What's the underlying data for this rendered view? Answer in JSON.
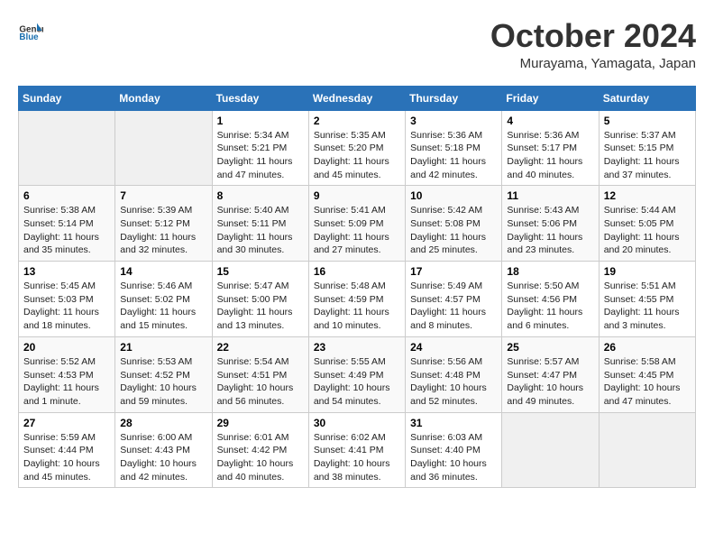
{
  "header": {
    "logo_general": "General",
    "logo_blue": "Blue",
    "month_title": "October 2024",
    "subtitle": "Murayama, Yamagata, Japan"
  },
  "columns": [
    "Sunday",
    "Monday",
    "Tuesday",
    "Wednesday",
    "Thursday",
    "Friday",
    "Saturday"
  ],
  "weeks": [
    [
      {
        "day": "",
        "info": ""
      },
      {
        "day": "",
        "info": ""
      },
      {
        "day": "1",
        "info": "Sunrise: 5:34 AM\nSunset: 5:21 PM\nDaylight: 11 hours and 47 minutes."
      },
      {
        "day": "2",
        "info": "Sunrise: 5:35 AM\nSunset: 5:20 PM\nDaylight: 11 hours and 45 minutes."
      },
      {
        "day": "3",
        "info": "Sunrise: 5:36 AM\nSunset: 5:18 PM\nDaylight: 11 hours and 42 minutes."
      },
      {
        "day": "4",
        "info": "Sunrise: 5:36 AM\nSunset: 5:17 PM\nDaylight: 11 hours and 40 minutes."
      },
      {
        "day": "5",
        "info": "Sunrise: 5:37 AM\nSunset: 5:15 PM\nDaylight: 11 hours and 37 minutes."
      }
    ],
    [
      {
        "day": "6",
        "info": "Sunrise: 5:38 AM\nSunset: 5:14 PM\nDaylight: 11 hours and 35 minutes."
      },
      {
        "day": "7",
        "info": "Sunrise: 5:39 AM\nSunset: 5:12 PM\nDaylight: 11 hours and 32 minutes."
      },
      {
        "day": "8",
        "info": "Sunrise: 5:40 AM\nSunset: 5:11 PM\nDaylight: 11 hours and 30 minutes."
      },
      {
        "day": "9",
        "info": "Sunrise: 5:41 AM\nSunset: 5:09 PM\nDaylight: 11 hours and 27 minutes."
      },
      {
        "day": "10",
        "info": "Sunrise: 5:42 AM\nSunset: 5:08 PM\nDaylight: 11 hours and 25 minutes."
      },
      {
        "day": "11",
        "info": "Sunrise: 5:43 AM\nSunset: 5:06 PM\nDaylight: 11 hours and 23 minutes."
      },
      {
        "day": "12",
        "info": "Sunrise: 5:44 AM\nSunset: 5:05 PM\nDaylight: 11 hours and 20 minutes."
      }
    ],
    [
      {
        "day": "13",
        "info": "Sunrise: 5:45 AM\nSunset: 5:03 PM\nDaylight: 11 hours and 18 minutes."
      },
      {
        "day": "14",
        "info": "Sunrise: 5:46 AM\nSunset: 5:02 PM\nDaylight: 11 hours and 15 minutes."
      },
      {
        "day": "15",
        "info": "Sunrise: 5:47 AM\nSunset: 5:00 PM\nDaylight: 11 hours and 13 minutes."
      },
      {
        "day": "16",
        "info": "Sunrise: 5:48 AM\nSunset: 4:59 PM\nDaylight: 11 hours and 10 minutes."
      },
      {
        "day": "17",
        "info": "Sunrise: 5:49 AM\nSunset: 4:57 PM\nDaylight: 11 hours and 8 minutes."
      },
      {
        "day": "18",
        "info": "Sunrise: 5:50 AM\nSunset: 4:56 PM\nDaylight: 11 hours and 6 minutes."
      },
      {
        "day": "19",
        "info": "Sunrise: 5:51 AM\nSunset: 4:55 PM\nDaylight: 11 hours and 3 minutes."
      }
    ],
    [
      {
        "day": "20",
        "info": "Sunrise: 5:52 AM\nSunset: 4:53 PM\nDaylight: 11 hours and 1 minute."
      },
      {
        "day": "21",
        "info": "Sunrise: 5:53 AM\nSunset: 4:52 PM\nDaylight: 10 hours and 59 minutes."
      },
      {
        "day": "22",
        "info": "Sunrise: 5:54 AM\nSunset: 4:51 PM\nDaylight: 10 hours and 56 minutes."
      },
      {
        "day": "23",
        "info": "Sunrise: 5:55 AM\nSunset: 4:49 PM\nDaylight: 10 hours and 54 minutes."
      },
      {
        "day": "24",
        "info": "Sunrise: 5:56 AM\nSunset: 4:48 PM\nDaylight: 10 hours and 52 minutes."
      },
      {
        "day": "25",
        "info": "Sunrise: 5:57 AM\nSunset: 4:47 PM\nDaylight: 10 hours and 49 minutes."
      },
      {
        "day": "26",
        "info": "Sunrise: 5:58 AM\nSunset: 4:45 PM\nDaylight: 10 hours and 47 minutes."
      }
    ],
    [
      {
        "day": "27",
        "info": "Sunrise: 5:59 AM\nSunset: 4:44 PM\nDaylight: 10 hours and 45 minutes."
      },
      {
        "day": "28",
        "info": "Sunrise: 6:00 AM\nSunset: 4:43 PM\nDaylight: 10 hours and 42 minutes."
      },
      {
        "day": "29",
        "info": "Sunrise: 6:01 AM\nSunset: 4:42 PM\nDaylight: 10 hours and 40 minutes."
      },
      {
        "day": "30",
        "info": "Sunrise: 6:02 AM\nSunset: 4:41 PM\nDaylight: 10 hours and 38 minutes."
      },
      {
        "day": "31",
        "info": "Sunrise: 6:03 AM\nSunset: 4:40 PM\nDaylight: 10 hours and 36 minutes."
      },
      {
        "day": "",
        "info": ""
      },
      {
        "day": "",
        "info": ""
      }
    ]
  ]
}
